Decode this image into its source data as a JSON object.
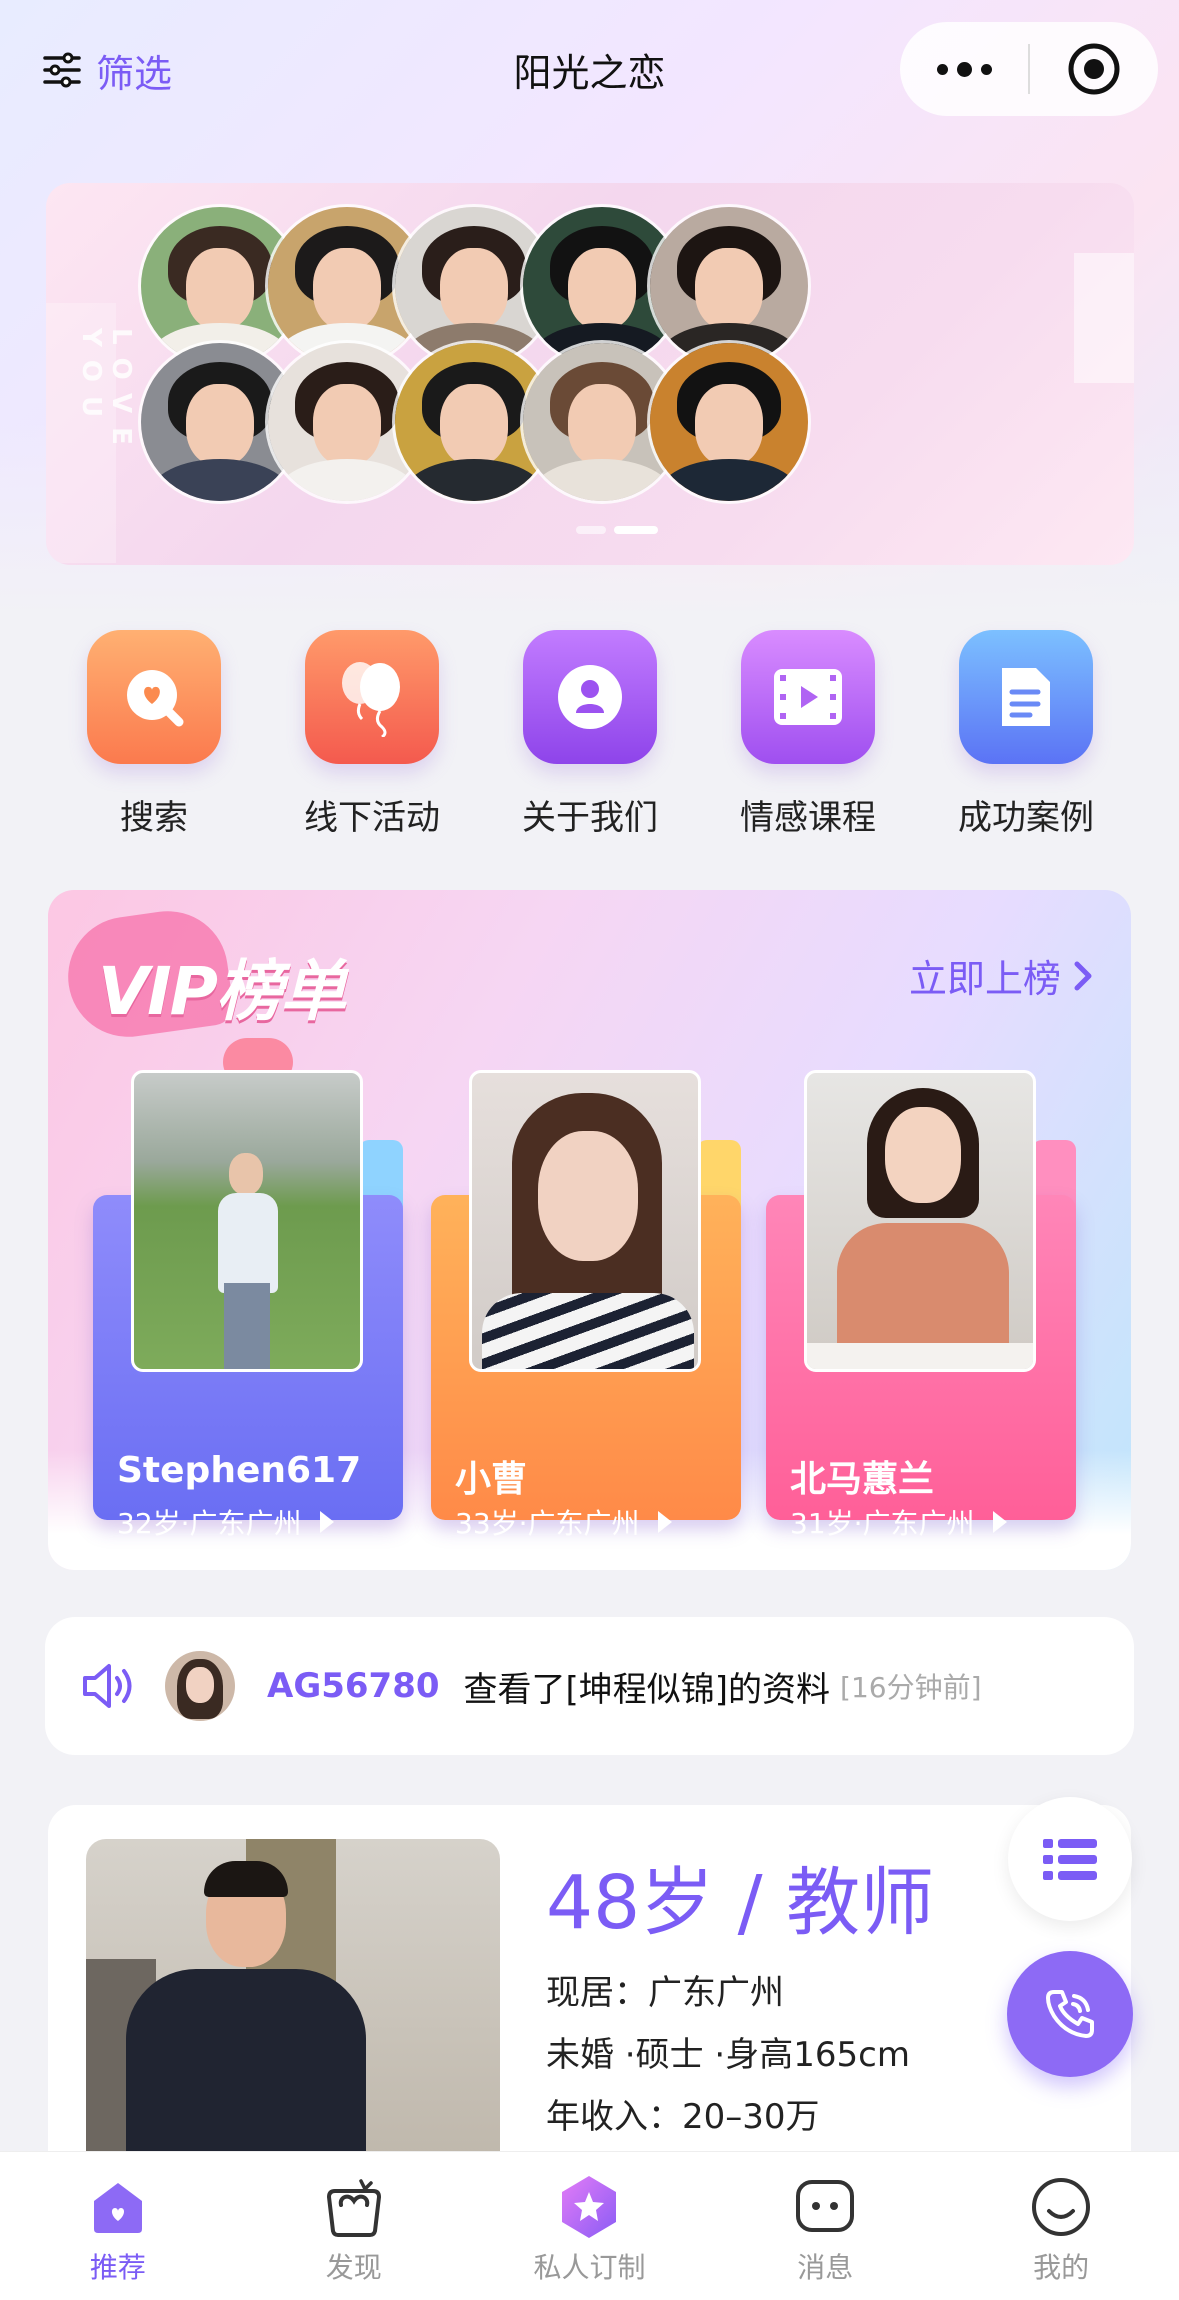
{
  "nav": {
    "filter_label": "筛选",
    "title": "阳光之恋"
  },
  "banner": {
    "side_text": "LOVE YOU",
    "avatars": [
      {
        "bg": "#8ab07a",
        "hair": "#3a2a22",
        "body": "#f2efe9"
      },
      {
        "bg": "#c8a46c",
        "hair": "#1c1a1a",
        "body": "#f4f4f2"
      },
      {
        "bg": "#d9d6d2",
        "hair": "#2a1e1a",
        "body": "#8d7b6c"
      },
      {
        "bg": "#2e4a3a",
        "hair": "#121212",
        "body": "#151a22"
      },
      {
        "bg": "#b9aaa0",
        "hair": "#1d1512",
        "body": "#2a2624"
      },
      {
        "bg": "#8a8c92",
        "hair": "#1a1a1a",
        "body": "#3a4256"
      },
      {
        "bg": "#e7e1dc",
        "hair": "#2a1d18",
        "body": "#f3f1ee"
      },
      {
        "bg": "#c9a240",
        "hair": "#1a1a1a",
        "body": "#252a30"
      },
      {
        "bg": "#c8c2ba",
        "hair": "#6a4a36",
        "body": "#e8e2da"
      },
      {
        "bg": "#c9822e",
        "hair": "#121212",
        "body": "#1d2836"
      }
    ]
  },
  "quick_menu": [
    {
      "label": "搜索",
      "icon": "search-icon",
      "color_from": "#ffb072",
      "color_to": "#fb7a4e"
    },
    {
      "label": "线下活动",
      "icon": "balloon-icon",
      "color_from": "#ff9a6a",
      "color_to": "#f45a4e"
    },
    {
      "label": "关于我们",
      "icon": "user-circle-icon",
      "color_from": "#c27cff",
      "color_to": "#8e44ea"
    },
    {
      "label": "情感课程",
      "icon": "video-icon",
      "color_from": "#d98cff",
      "color_to": "#9f4ff0"
    },
    {
      "label": "成功案例",
      "icon": "document-icon",
      "color_from": "#7cc0ff",
      "color_to": "#5b73f5"
    }
  ],
  "vip": {
    "logo_text": "VIP榜单",
    "more_label": "立即上榜",
    "cards": [
      {
        "name": "Stephen617",
        "info": "32岁·广东广州",
        "from": "#8f8cfb",
        "to": "#6a6ef3",
        "tab": "#8fd3ff"
      },
      {
        "name": "小曹",
        "info": "33岁·广东广州",
        "from": "#ffb25a",
        "to": "#ff8a48",
        "tab": "#ffd66a"
      },
      {
        "name": "北马蕙兰",
        "info": "31岁·广东广州",
        "from": "#ff86b8",
        "to": "#ff5f98",
        "tab": "#ff8fbf"
      }
    ]
  },
  "notice": {
    "user": "AG56780",
    "message": "查看了[坤程似锦]的资料",
    "time": "[16分钟前]"
  },
  "profile": {
    "headline": "48岁 / 教师",
    "residence": "现居：广东广州",
    "details": "未婚 ·硕士 ·身高165cm",
    "income": "年收入：20–30万"
  },
  "tabs": [
    {
      "label": "推荐",
      "icon": "home-icon",
      "active": true
    },
    {
      "label": "发现",
      "icon": "discover-icon",
      "active": false
    },
    {
      "label": "私人订制",
      "icon": "star-icon",
      "active": false
    },
    {
      "label": "消息",
      "icon": "message-icon",
      "active": false
    },
    {
      "label": "我的",
      "icon": "profile-icon",
      "active": false
    }
  ],
  "colors": {
    "accent": "#7b5cf5"
  }
}
